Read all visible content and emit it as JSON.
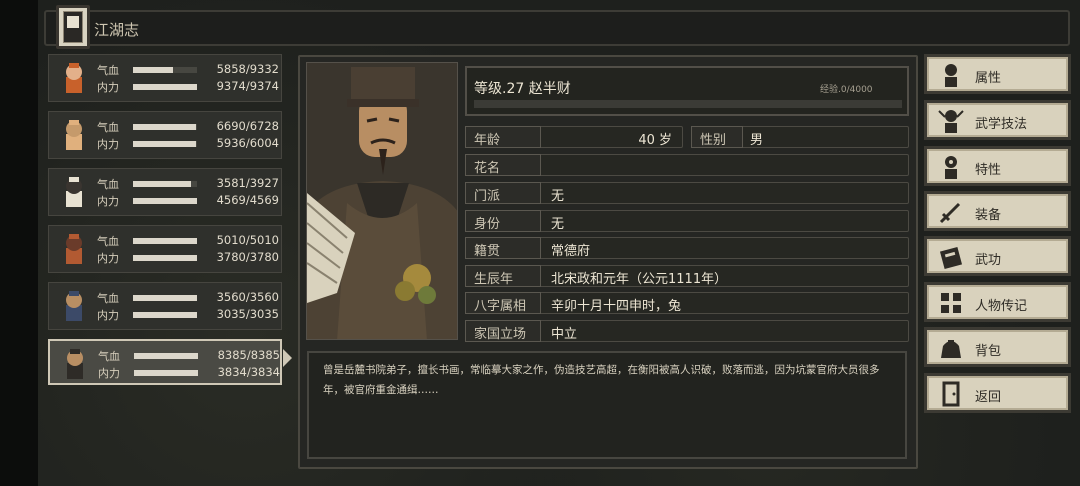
{
  "header": {
    "title": "江湖志"
  },
  "party": [
    {
      "hp_label": "气血",
      "mp_label": "内力",
      "hp": "5858/9332",
      "mp": "9374/9374",
      "hp_ratio": 0.63,
      "mp_ratio": 1.0
    },
    {
      "hp_label": "气血",
      "mp_label": "内力",
      "hp": "6690/6728",
      "mp": "5936/6004",
      "hp_ratio": 0.99,
      "mp_ratio": 0.99
    },
    {
      "hp_label": "气血",
      "mp_label": "内力",
      "hp": "3581/3927",
      "mp": "4569/4569",
      "hp_ratio": 0.91,
      "mp_ratio": 1.0
    },
    {
      "hp_label": "气血",
      "mp_label": "内力",
      "hp": "5010/5010",
      "mp": "3780/3780",
      "hp_ratio": 1.0,
      "mp_ratio": 1.0
    },
    {
      "hp_label": "气血",
      "mp_label": "内力",
      "hp": "3560/3560",
      "mp": "3035/3035",
      "hp_ratio": 1.0,
      "mp_ratio": 1.0
    },
    {
      "hp_label": "气血",
      "mp_label": "内力",
      "hp": "8385/8385",
      "mp": "3834/3834",
      "hp_ratio": 1.0,
      "mp_ratio": 1.0
    }
  ],
  "character": {
    "level_line": "等级.27 赵半财",
    "exp": "经验.0/4000",
    "age_label": "年龄",
    "age_value": "40 岁",
    "gender_label": "性别",
    "gender_value": "男",
    "alias_label": "花名",
    "alias_value": "",
    "sect_label": "门派",
    "sect_value": "无",
    "status_label": "身份",
    "status_value": "无",
    "origin_label": "籍贯",
    "origin_value": "常德府",
    "birth_label": "生辰年",
    "birth_value": "北宋政和元年（公元1111年）",
    "bazi_label": "八字属相",
    "bazi_value": "辛卯十月十四申时，兔",
    "stance_label": "家国立场",
    "stance_value": "中立",
    "bio": "曾是岳麓书院弟子，擅长书画，常临摹大家之作，伪造技艺高超，在衡阳被高人识破，败落而逃，因为坑蒙官府大员很多年，被官府重金通缉……"
  },
  "menu": [
    {
      "label": "属性",
      "icon": "person-stats-icon"
    },
    {
      "label": "武学技法",
      "icon": "martial-skill-icon"
    },
    {
      "label": "特性",
      "icon": "trait-icon"
    },
    {
      "label": "装备",
      "icon": "sword-icon"
    },
    {
      "label": "武功",
      "icon": "manual-book-icon"
    },
    {
      "label": "人物传记",
      "icon": "biography-icon"
    },
    {
      "label": "背包",
      "icon": "bag-icon"
    },
    {
      "label": "返回",
      "icon": "door-exit-icon"
    }
  ]
}
